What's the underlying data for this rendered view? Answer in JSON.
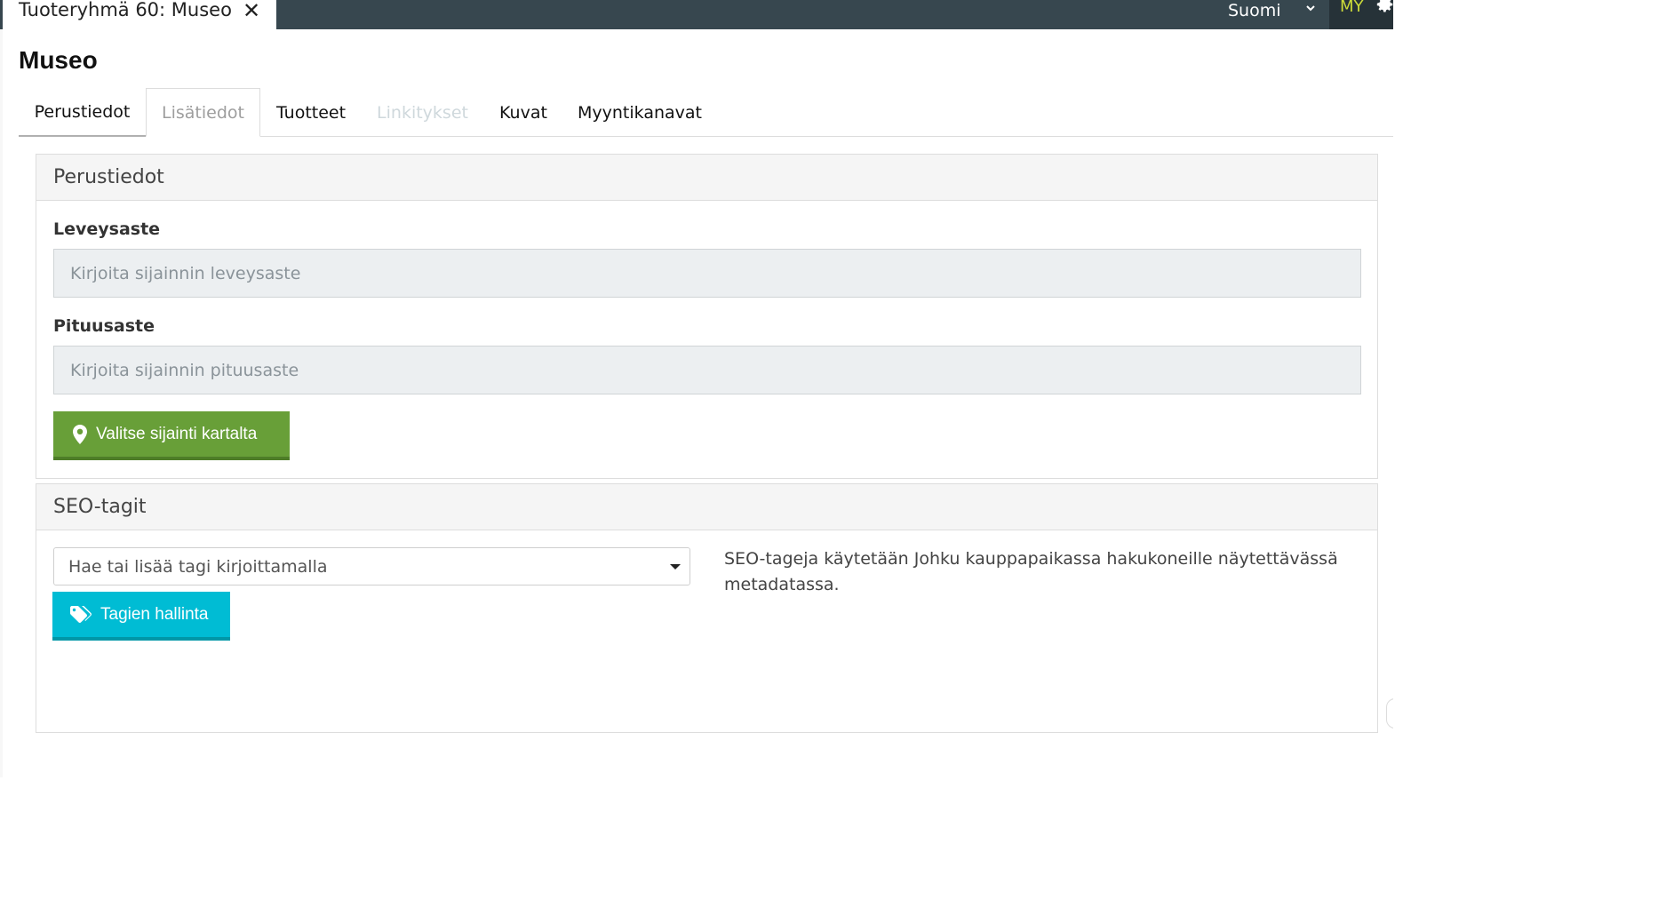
{
  "topbar": {
    "doc_tab_title": "Tuoteryhmä 60: Museo",
    "close_symbol": "✕",
    "language": "Suomi",
    "user_initials": "MY",
    "accent_color": "#cddc39",
    "bar_color": "#37474f"
  },
  "page": {
    "title": "Museo"
  },
  "tabs": [
    {
      "label": "Perustiedot"
    },
    {
      "label": "Lisätiedot"
    },
    {
      "label": "Tuotteet"
    },
    {
      "label": "Linkitykset"
    },
    {
      "label": "Kuvat"
    },
    {
      "label": "Myyntikanavat"
    }
  ],
  "basic_panel": {
    "title": "Perustiedot",
    "latitude_label": "Leveysaste",
    "latitude_placeholder": "Kirjoita sijainnin leveysaste",
    "latitude_value": "",
    "longitude_label": "Pituusaste",
    "longitude_placeholder": "Kirjoita sijainnin pituusaste",
    "longitude_value": "",
    "map_button": "Valitse sijainti kartalta",
    "map_button_icon": "map-marker-icon",
    "map_button_color": "#689f38"
  },
  "seo_panel": {
    "title": "SEO-tagit",
    "tag_select_placeholder": "Hae tai lisää tagi kirjoittamalla",
    "manage_button": "Tagien hallinta",
    "manage_button_icon": "tags-icon",
    "manage_button_color": "#00bcd4",
    "help_text": "SEO-tageja käytetään Johku kauppapaikassa hakukoneille näytettävässä metadatassa."
  }
}
